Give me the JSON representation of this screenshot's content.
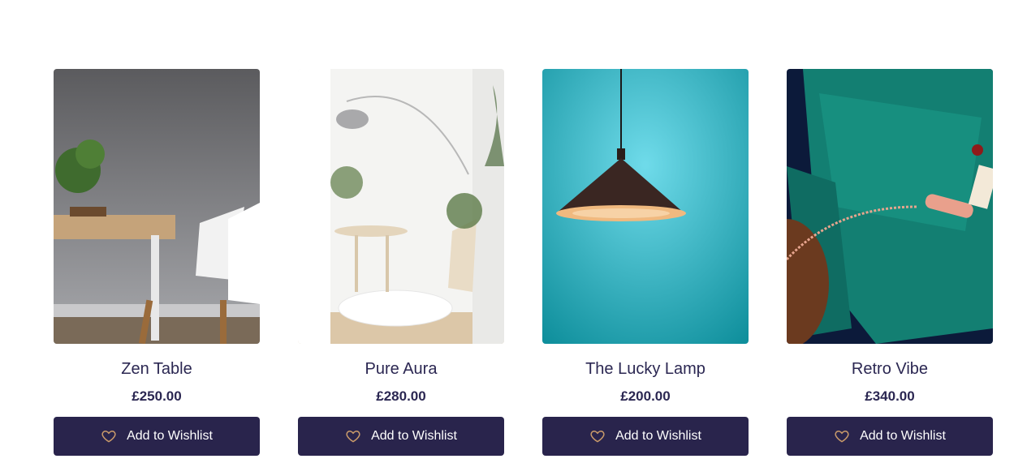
{
  "products": [
    {
      "name": "Zen Table",
      "price": "£250.00",
      "button_label": "Add to Wishlist",
      "image": "zen-table-photo"
    },
    {
      "name": "Pure Aura",
      "price": "£280.00",
      "button_label": "Add to Wishlist",
      "image": "pure-aura-photo"
    },
    {
      "name": "The Lucky Lamp",
      "price": "£200.00",
      "button_label": "Add to Wishlist",
      "image": "lucky-lamp-photo"
    },
    {
      "name": "Retro Vibe",
      "price": "£340.00",
      "button_label": "Add to Wishlist",
      "image": "retro-vibe-photo"
    }
  ],
  "colors": {
    "button_bg": "#29244c",
    "text": "#2b2752",
    "heart_icon": "#c99a6a"
  }
}
